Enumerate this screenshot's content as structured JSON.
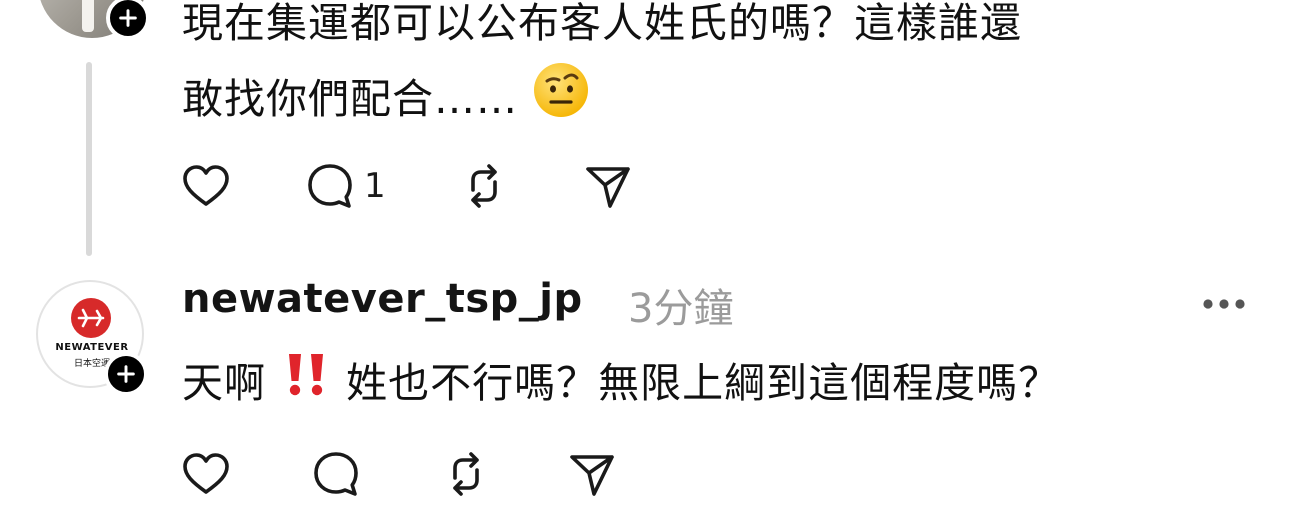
{
  "post1": {
    "text_line1": "現在集運都可以公布客人姓氏的嗎？這樣誰還",
    "text_line2": "敢找你們配合……",
    "emoji": "raised-eyebrow-emoji",
    "reply_count": "1"
  },
  "post2": {
    "username": "newatever_tsp_jp",
    "time": "3分鐘",
    "text_part1": "天啊",
    "emoji": "double-exclamation-emoji",
    "text_part2": "姓也不行嗎？無限上綱到這個程度嗎？",
    "avatar_line1": "NEWATEVER",
    "avatar_line2": "日本空運"
  },
  "icons": [
    "plus-icon",
    "heart-icon",
    "comment-icon",
    "repost-icon",
    "share-icon",
    "more-icon"
  ],
  "colors": {
    "logo_red": "#d72a2a",
    "muted": "#9b9b9b"
  }
}
